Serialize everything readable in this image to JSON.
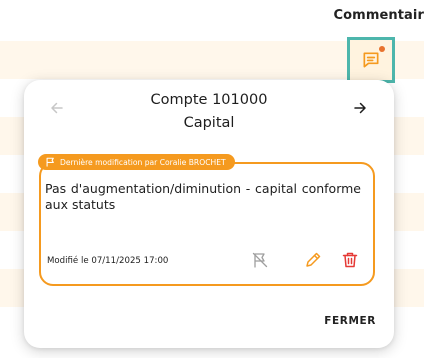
{
  "background": {
    "column_header": "Commentair"
  },
  "comment_button": {
    "icon": "comment-icon",
    "has_notification": true
  },
  "modal": {
    "title_line1": "Compte 101000",
    "title_line2": "Capital",
    "prev_icon": "arrow-left-icon",
    "next_icon": "arrow-right-icon",
    "badge": {
      "icon": "flag-icon",
      "label": "Dernière modification par Coralie BROCHET"
    },
    "comment": {
      "text": "Pas d'augmentation/diminution - capital conforme aux statuts",
      "modified": "Modifié le 07/11/2025 17:00"
    },
    "actions": [
      {
        "name": "unflag",
        "icon": "flag-off-icon"
      },
      {
        "name": "edit",
        "icon": "pencil-icon"
      },
      {
        "name": "delete",
        "icon": "trash-icon"
      }
    ],
    "close_label": "FERMER"
  },
  "colors": {
    "accent_orange": "#f59a1f",
    "teal_focus": "#4db6ac",
    "row_tint": "#fff7eb",
    "delete_red": "#e53935"
  }
}
